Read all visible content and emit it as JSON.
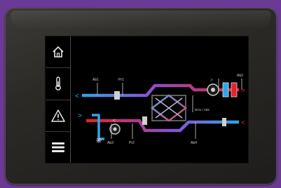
{
  "sidebar": {
    "items": [
      {
        "icon": "home-icon"
      },
      {
        "icon": "thermometer-icon"
      },
      {
        "icon": "warning-icon"
      },
      {
        "icon": "menu-icon"
      }
    ]
  },
  "diagram": {
    "labels": {
      "sensor_top_left": "Ab1",
      "sensor_top_mid": "Pr1",
      "sensor_top_right": "Ab2",
      "sensor_bottom_left": "Ab3",
      "sensor_bottom_mid": "Pr2",
      "sensor_bottom_right": "Ab4",
      "bypass": "DO1 / Ab5"
    },
    "arrows": {
      "left_top": "<",
      "right_top": ">",
      "right_bottom": "<",
      "left_bottom": ">"
    }
  },
  "colors": {
    "cold": "#2fa5e8",
    "hot": "#e3222e",
    "frame": "#2c2b28",
    "background": "#6b3a95"
  }
}
